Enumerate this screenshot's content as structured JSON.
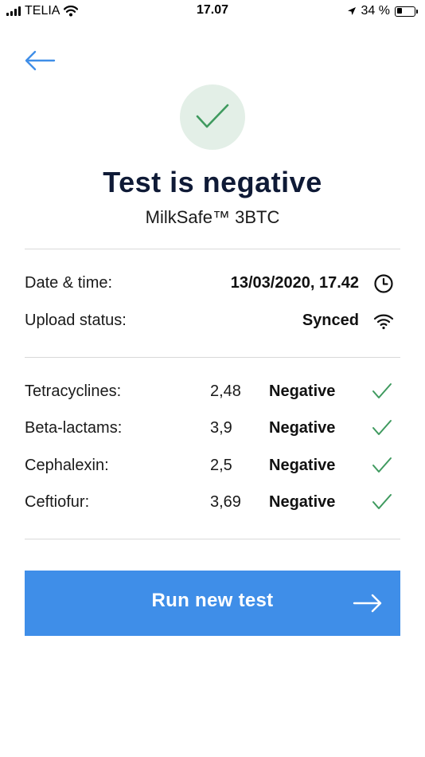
{
  "status_bar": {
    "carrier": "TELIA",
    "time": "17.07",
    "battery": "34 %",
    "battery_level": 0.34
  },
  "header": {
    "back_icon": "arrow-left-icon",
    "result_icon": "check-icon",
    "title": "Test is negative",
    "subtitle": "MilkSafe™ 3BTC"
  },
  "info": {
    "date_label": "Date & time:",
    "date_value": "13/03/2020, 17.42",
    "date_icon": "clock-icon",
    "upload_label": "Upload status:",
    "upload_value": "Synced",
    "upload_icon": "wifi-icon"
  },
  "results": [
    {
      "name": "Tetracyclines:",
      "value": "2,48",
      "status": "Negative",
      "icon": "check-icon"
    },
    {
      "name": "Beta-lactams:",
      "value": "3,9",
      "status": "Negative",
      "icon": "check-icon"
    },
    {
      "name": "Cephalexin:",
      "value": "2,5",
      "status": "Negative",
      "icon": "check-icon"
    },
    {
      "name": "Ceftiofur:",
      "value": "3,69",
      "status": "Negative",
      "icon": "check-icon"
    }
  ],
  "actions": {
    "run_label": "Run new test",
    "run_icon": "arrow-right-icon"
  },
  "colors": {
    "accent_blue": "#3f8ee8",
    "success_green": "#3f9a5f",
    "success_bg": "#e3efe7",
    "title_navy": "#0f1a36"
  }
}
